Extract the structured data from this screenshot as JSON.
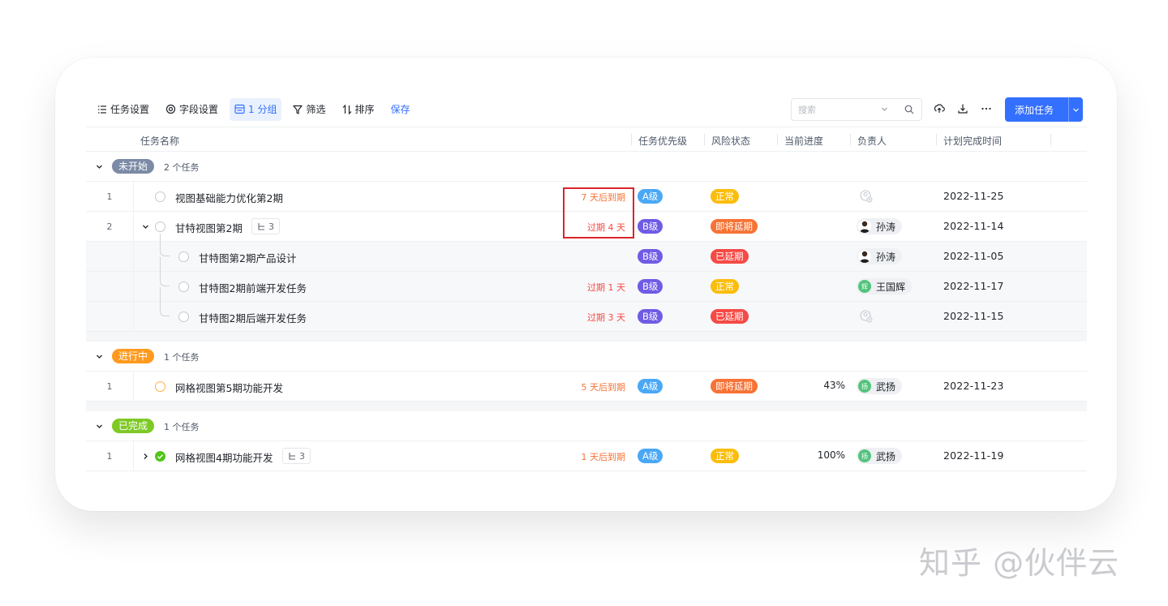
{
  "toolbar": {
    "task_settings": "任务设置",
    "field_settings": "字段设置",
    "group": "1 分组",
    "filter": "筛选",
    "sort": "排序",
    "save": "保存",
    "search_placeholder": "搜索",
    "add_task": "添加任务"
  },
  "columns": {
    "name": "任务名称",
    "priority": "任务优先级",
    "risk": "风险状态",
    "progress": "当前进度",
    "owner": "负责人",
    "due_date": "计划完成时间"
  },
  "groups": [
    {
      "label": "未开始",
      "count": "2 个任务",
      "color": "#7b8aa5",
      "rows": [
        {
          "idx": "1",
          "name": "视图基础能力优化第2期",
          "due": "7 天后到期",
          "priority": "A级",
          "risk": "正常",
          "progress": "",
          "owner": "",
          "date": "2022-11-25"
        },
        {
          "idx": "2",
          "name": "甘特视图第2期",
          "sub_count": "3",
          "due": "过期 4 天",
          "priority": "B级",
          "risk": "即将延期",
          "progress": "",
          "owner": "孙涛",
          "date": "2022-11-14"
        },
        {
          "idx": "",
          "name": "甘特图第2期产品设计",
          "due": "",
          "priority": "B级",
          "risk": "已延期",
          "progress": "",
          "owner": "孙涛",
          "date": "2022-11-05"
        },
        {
          "idx": "",
          "name": "甘特图2期前端开发任务",
          "due": "过期 1 天",
          "priority": "B级",
          "risk": "正常",
          "progress": "",
          "owner": "王国辉",
          "owner_initial": "辉",
          "date": "2022-11-17"
        },
        {
          "idx": "",
          "name": "甘特图2期后端开发任务",
          "due": "过期 3 天",
          "priority": "B级",
          "risk": "已延期",
          "progress": "",
          "owner": "",
          "date": "2022-11-15"
        }
      ]
    },
    {
      "label": "进行中",
      "count": "1 个任务",
      "color": "#ff9a1f",
      "rows": [
        {
          "idx": "1",
          "name": "网格视图第5期功能开发",
          "due": "5 天后到期",
          "priority": "A级",
          "risk": "即将延期",
          "progress": "43%",
          "owner": "武扬",
          "owner_initial": "扬",
          "date": "2022-11-23"
        }
      ]
    },
    {
      "label": "已完成",
      "count": "1 个任务",
      "color": "#7ec925",
      "rows": [
        {
          "idx": "1",
          "name": "网格视图4期功能开发",
          "sub_count": "3",
          "due": "1 天后到期",
          "priority": "A级",
          "risk": "正常",
          "progress": "100%",
          "owner": "武扬",
          "owner_initial": "扬",
          "date": "2022-11-19"
        }
      ]
    }
  ],
  "colors": {
    "priority_a": "#4aa8f5",
    "priority_b": "#6f5ce5",
    "risk_normal": "#fbbd0d",
    "risk_soon": "#f77234",
    "risk_delayed": "#f54a45",
    "accent": "#3370ff"
  },
  "watermark": "知乎 @伙伴云"
}
